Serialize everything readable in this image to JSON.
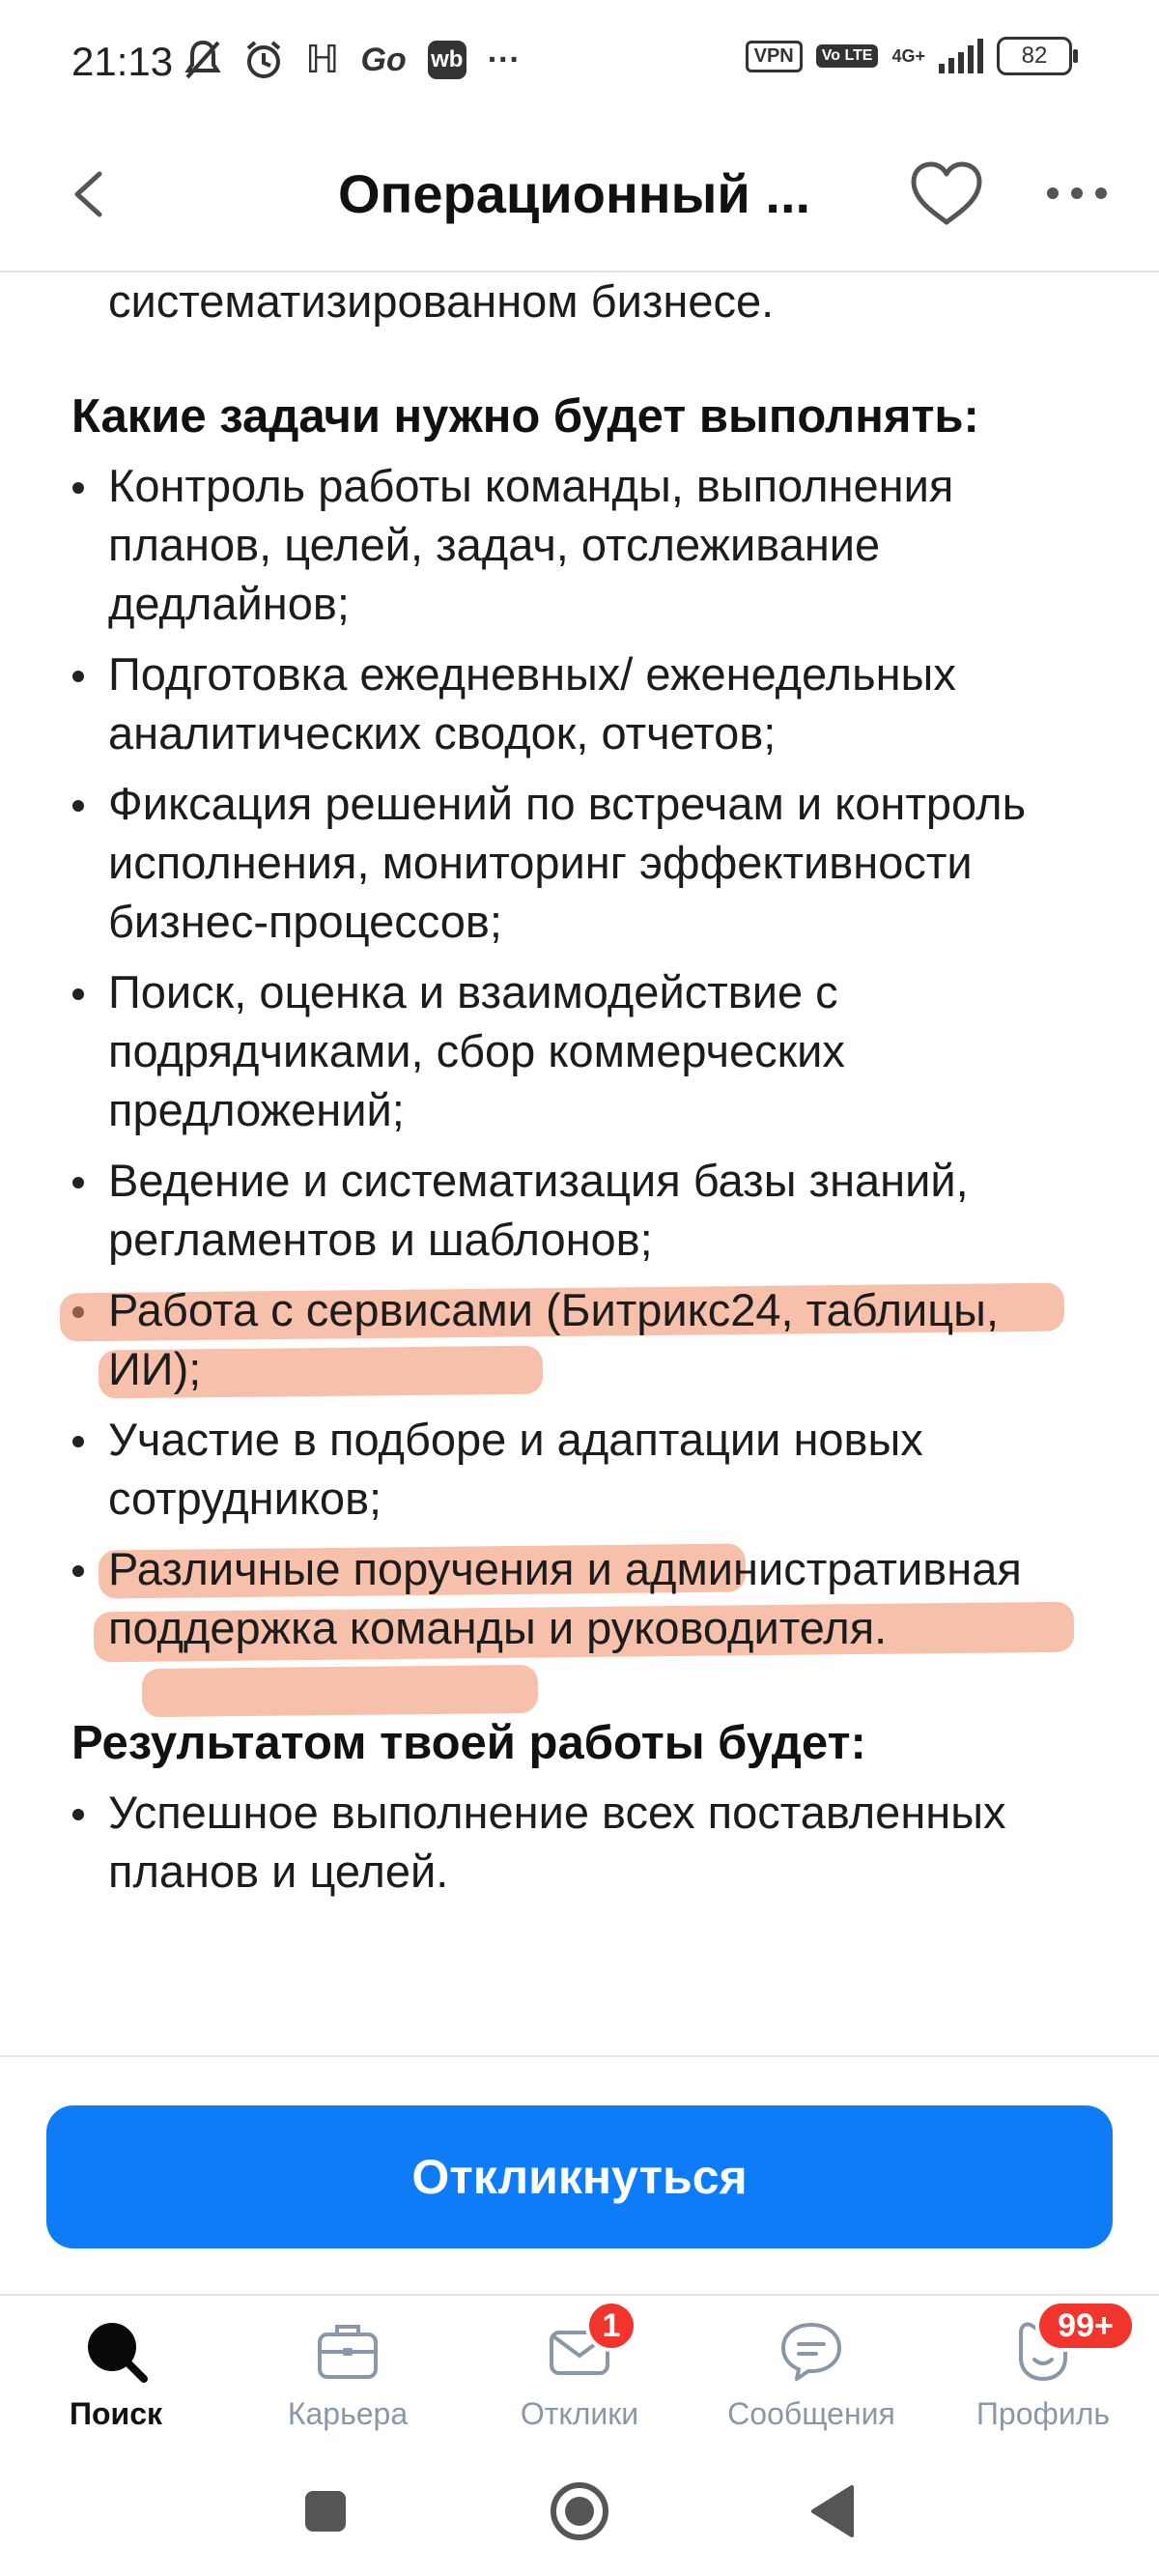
{
  "status_bar": {
    "time": "21:13",
    "icons": [
      "muted-bell-icon",
      "alarm-icon",
      "h-app-icon",
      "go-app-icon",
      "wb-app-icon",
      "more-dots-icon"
    ],
    "vpn": "VPN",
    "volte": "Vo LTE",
    "network": "4G+",
    "battery": "82"
  },
  "header": {
    "title": "Операционный ...",
    "back_icon": "chevron-left-icon",
    "favorite_icon": "heart-icon",
    "more_icon": "more-dots-icon"
  },
  "content": {
    "intro_tail": "влияние на результат, работа в систематизированном бизнесе.",
    "tasks_heading": "Какие задачи нужно будет выполнять:",
    "tasks": [
      "Контроль работы команды, выполнения планов, целей, задач, отслеживание дедлайнов;",
      "Подготовка ежедневных/ еженедельных аналитических сводок, отчетов;",
      "Фиксация решений по встречам и контроль исполнения, мониторинг эффективности бизнес-процессов;",
      "Поиск, оценка и взаимодействие с подрядчиками, сбор коммерческих предложений;",
      "Ведение и систематизация базы знаний, регламентов и шаблонов;",
      "Работа с сервисами (Битрикс24, таблицы, ИИ);",
      "Участие в подборе и адаптации новых сотрудников;",
      "Различные поручения и административная поддержка команды и руководителя."
    ],
    "results_heading": "Результатом твоей работы будет:",
    "results": [
      "Успешное выполнение всех поставленных планов и целей."
    ],
    "highlight_color": "#f08c64"
  },
  "action": {
    "respond_label": "Откликнуться",
    "color": "#0e7cf6"
  },
  "tabbar": {
    "tabs": [
      {
        "label": "Поиск",
        "icon": "search-icon",
        "active": true
      },
      {
        "label": "Карьера",
        "icon": "briefcase-icon"
      },
      {
        "label": "Отклики",
        "icon": "envelope-icon",
        "badge": "1"
      },
      {
        "label": "Сообщения",
        "icon": "chat-bubble-icon"
      },
      {
        "label": "Профиль",
        "icon": "profile-icon",
        "badge": "99+"
      }
    ],
    "badge_color": "#f2352c"
  },
  "android_nav": {
    "buttons": [
      "recent-apps-icon",
      "home-icon",
      "back-icon"
    ]
  }
}
